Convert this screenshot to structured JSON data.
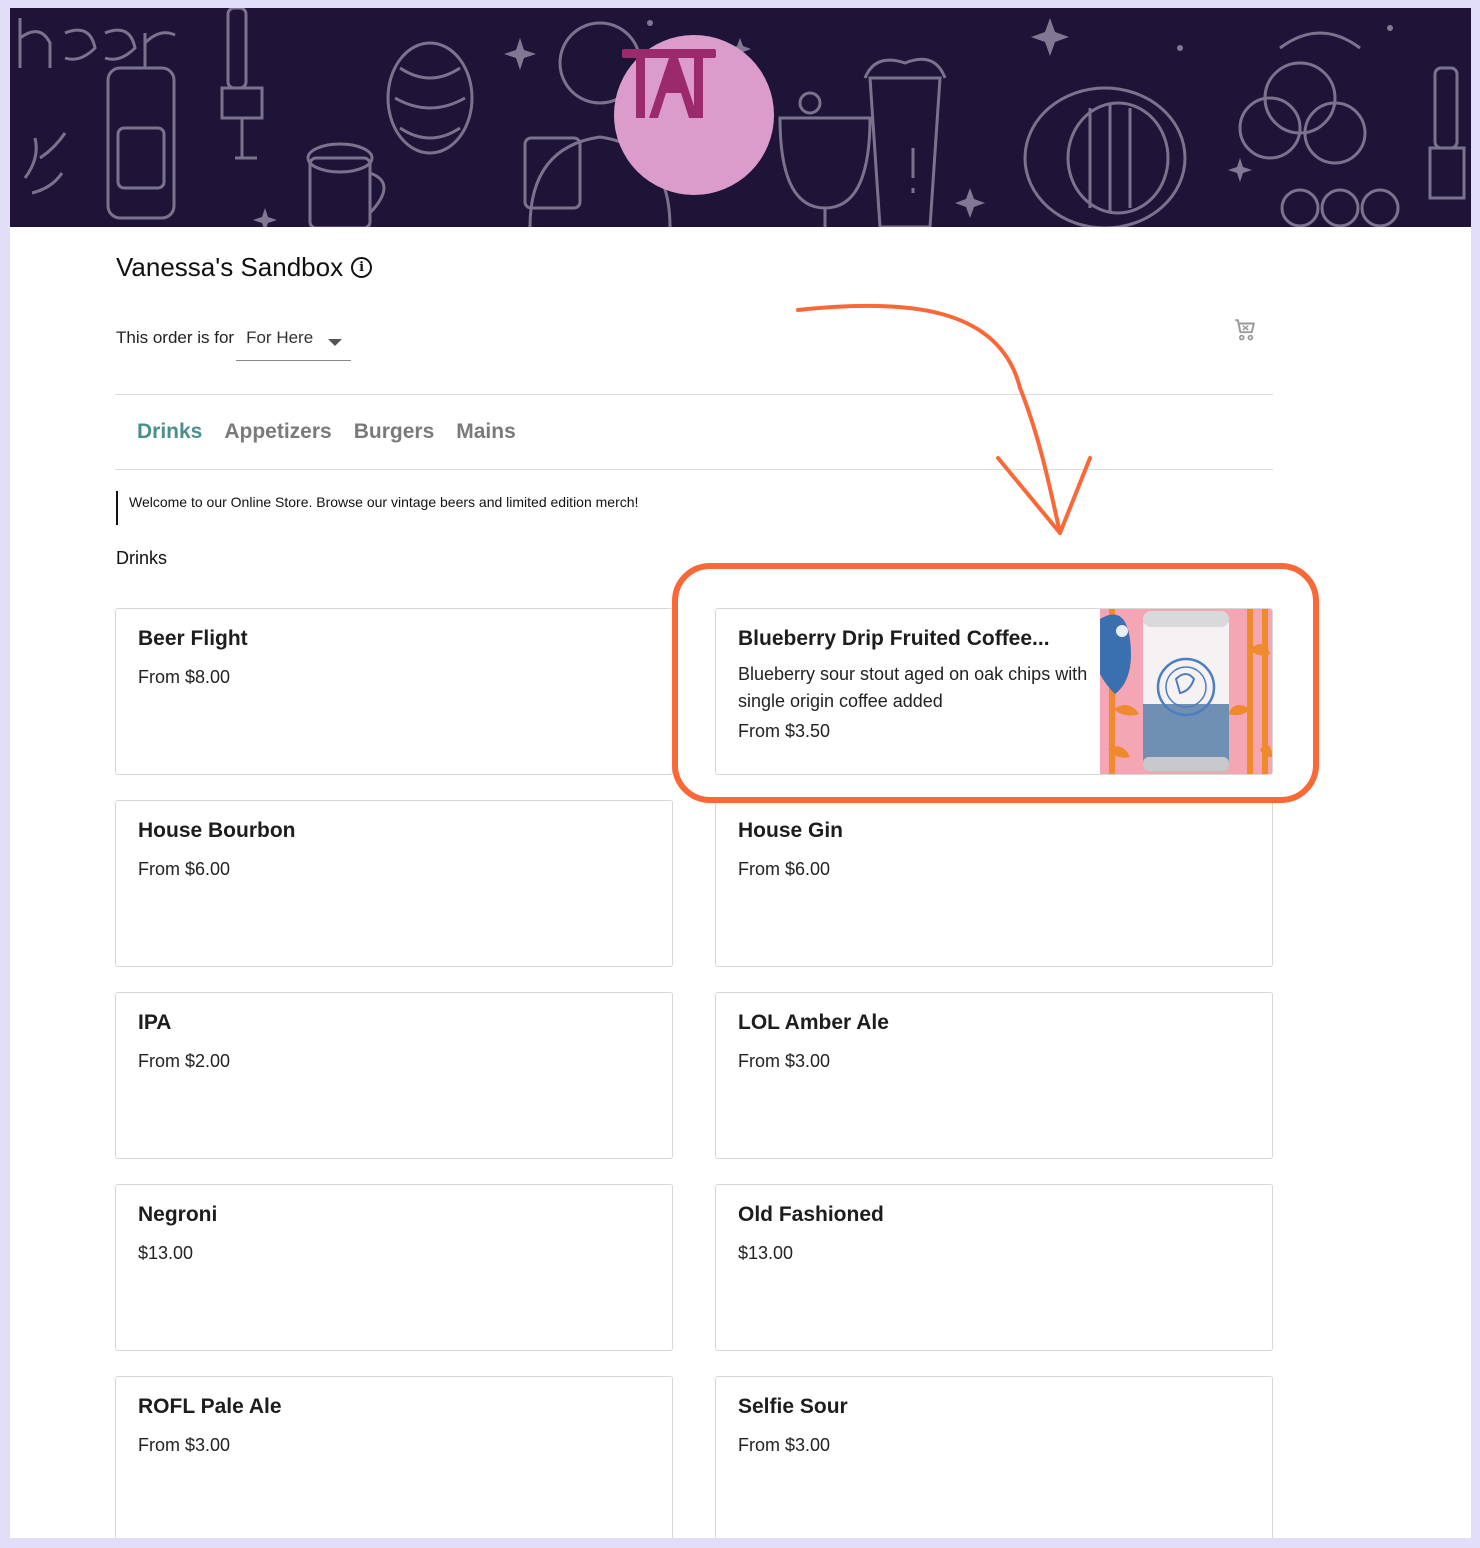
{
  "store": {
    "name": "Vanessa's Sandbox",
    "logo_text": "TAT",
    "logo_color": "#dc9ccb",
    "banner_color": "#1e1438"
  },
  "order": {
    "label": "This order is for",
    "selected": "For Here"
  },
  "tabs": [
    {
      "label": "Drinks",
      "active": true
    },
    {
      "label": "Appetizers",
      "active": false
    },
    {
      "label": "Burgers",
      "active": false
    },
    {
      "label": "Mains",
      "active": false
    }
  ],
  "welcome": "Welcome to our Online Store. Browse our vintage beers and limited edition merch!",
  "section_title": "Drinks",
  "items": [
    {
      "name": "Beer Flight",
      "price": "From $8.00"
    },
    {
      "name": "Blueberry Drip Fruited Coffee...",
      "description": "Blueberry sour stout aged on oak chips with single origin coffee added",
      "price": "From $3.50",
      "image": "beer-can"
    },
    {
      "name": "House Bourbon",
      "price": "From $6.00"
    },
    {
      "name": "House Gin",
      "price": "From $6.00"
    },
    {
      "name": "IPA",
      "price": "From $2.00"
    },
    {
      "name": "LOL Amber Ale",
      "price": "From $3.00"
    },
    {
      "name": "Negroni",
      "price": "$13.00"
    },
    {
      "name": "Old Fashioned",
      "price": "$13.00"
    },
    {
      "name": "ROFL Pale Ale",
      "price": "From $3.00"
    },
    {
      "name": "Selfie Sour",
      "price": "From $3.00"
    }
  ],
  "colors": {
    "accent_tab": "#4a8f8c",
    "annotation": "#fb6837",
    "page_background": "#e3def8"
  },
  "icons": {
    "info": "info-icon",
    "cart": "cart-icon",
    "dropdown": "chevron-down-icon"
  }
}
